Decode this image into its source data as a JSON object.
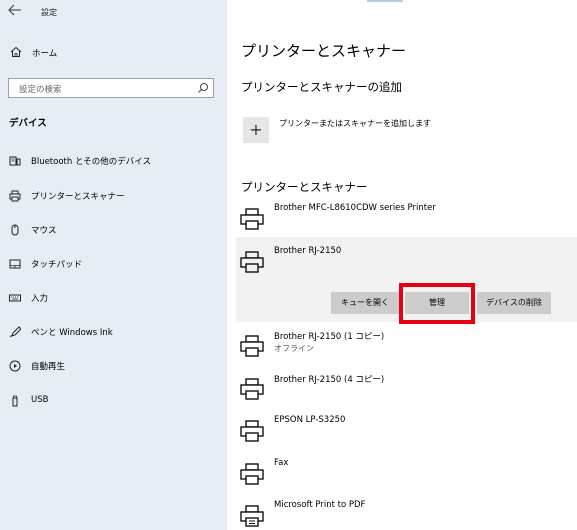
{
  "window": {
    "title": "設定"
  },
  "sidebar": {
    "home": "ホーム",
    "search_placeholder": "設定の検索",
    "section": "デバイス",
    "items": [
      {
        "label": "Bluetooth とその他のデバイス",
        "icon": "bluetooth-devices-icon"
      },
      {
        "label": "プリンターとスキャナー",
        "icon": "printer-icon"
      },
      {
        "label": "マウス",
        "icon": "mouse-icon"
      },
      {
        "label": "タッチパッド",
        "icon": "touchpad-icon"
      },
      {
        "label": "入力",
        "icon": "keyboard-icon"
      },
      {
        "label": "ペンと Windows Ink",
        "icon": "pen-icon"
      },
      {
        "label": "自動再生",
        "icon": "autoplay-icon"
      },
      {
        "label": "USB",
        "icon": "usb-icon"
      }
    ]
  },
  "main": {
    "title": "プリンターとスキャナー",
    "add_heading": "プリンターとスキャナーの追加",
    "add_label": "プリンターまたはスキャナーを追加します",
    "list_heading": "プリンターとスキャナー",
    "printers": [
      {
        "name": "Brother MFC-L8610CDW series Printer",
        "status": "",
        "icon": "printer-icon"
      },
      {
        "name": "Brother RJ-2150",
        "status": "",
        "icon": "printer-icon"
      },
      {
        "name": "Brother RJ-2150 (1 コピー)",
        "status": "オフライン",
        "icon": "printer-icon"
      },
      {
        "name": "Brother RJ-2150 (4 コピー)",
        "status": "",
        "icon": "printer-icon"
      },
      {
        "name": "EPSON LP-S3250",
        "status": "",
        "icon": "printer-icon"
      },
      {
        "name": "Fax",
        "status": "",
        "icon": "printer-icon"
      },
      {
        "name": "Microsoft Print to PDF",
        "status": "",
        "icon": "pdf-printer-icon"
      }
    ],
    "actions": {
      "open_queue": "キューを開く",
      "manage": "管理",
      "remove": "デバイスの削除"
    }
  },
  "colors": {
    "sidebar_bg": "#e6edf5",
    "button_bg": "#cccccc",
    "highlight": "#e60012",
    "selected_bg": "#f2f2f2"
  }
}
